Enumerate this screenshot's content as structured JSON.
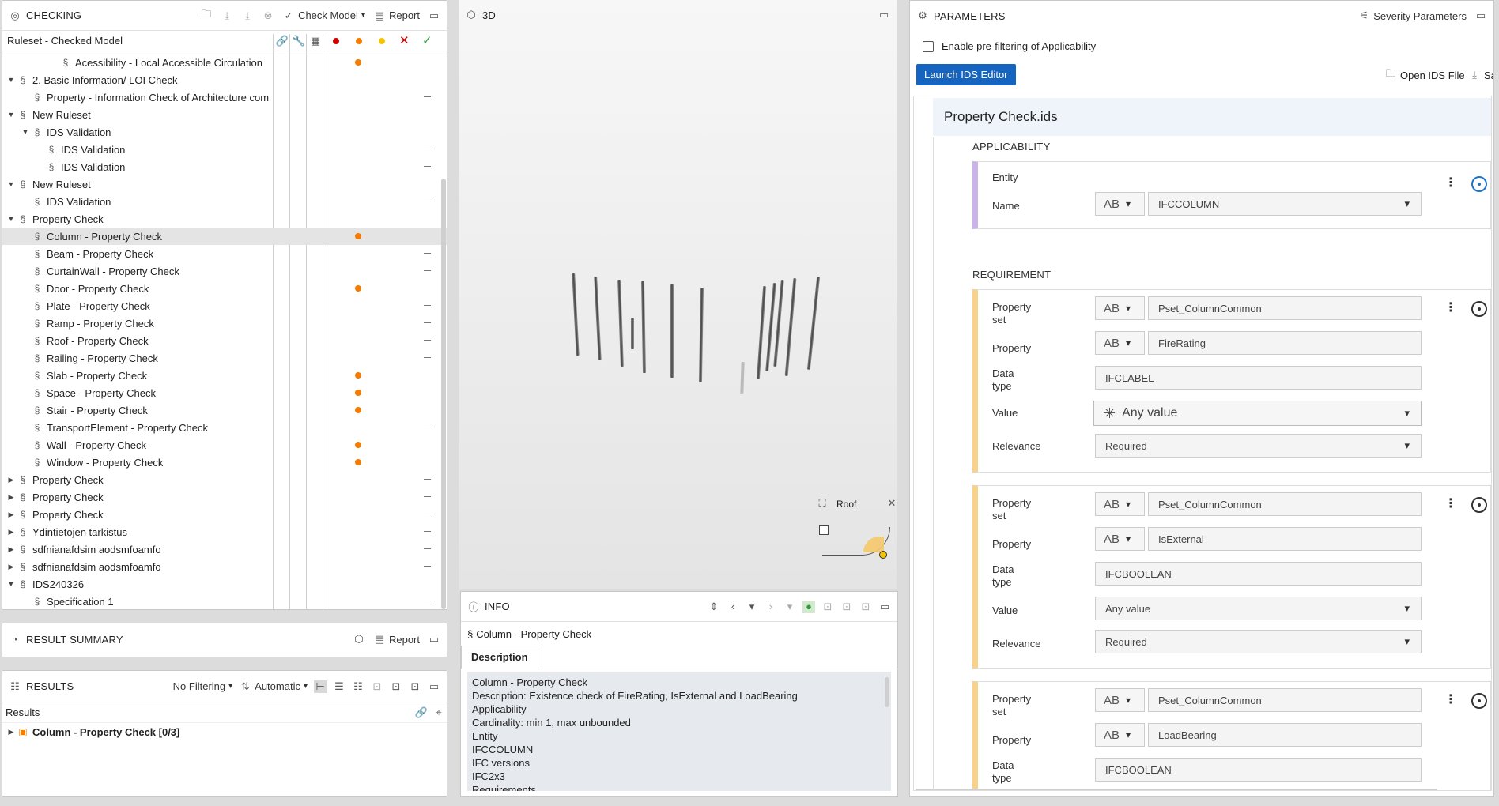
{
  "checking": {
    "title": "CHECKING",
    "check_model": "Check Model",
    "report": "Report",
    "tree_header": "Ruleset - Checked Model",
    "rows": [
      {
        "level": 3,
        "toggle": "",
        "glyph": "§",
        "label": "Acessibility - Local Accessible Circulation",
        "status": "dot"
      },
      {
        "level": 0,
        "toggle": "▼",
        "glyph": "§",
        "label": "2. Basic Information/ LOI Check",
        "status": ""
      },
      {
        "level": 1,
        "toggle": "",
        "glyph": "§",
        "label": "Property - Information Check of Architecture com",
        "status": "dash"
      },
      {
        "level": 0,
        "toggle": "▼",
        "glyph": "§",
        "label": "New Ruleset",
        "status": ""
      },
      {
        "level": 1,
        "toggle": "▼",
        "glyph": "§",
        "label": "IDS Validation",
        "status": ""
      },
      {
        "level": 2,
        "toggle": "",
        "glyph": "§",
        "label": "IDS Validation",
        "status": "dash"
      },
      {
        "level": 2,
        "toggle": "",
        "glyph": "§",
        "label": "IDS Validation",
        "status": "dash"
      },
      {
        "level": 0,
        "toggle": "▼",
        "glyph": "§",
        "label": "New Ruleset",
        "status": ""
      },
      {
        "level": 1,
        "toggle": "",
        "glyph": "§",
        "label": "IDS Validation",
        "status": "dash"
      },
      {
        "level": 0,
        "toggle": "▼",
        "glyph": "§",
        "label": "Property Check",
        "status": ""
      },
      {
        "level": 1,
        "toggle": "",
        "glyph": "§",
        "label": "Column - Property Check",
        "status": "dot",
        "selected": true
      },
      {
        "level": 1,
        "toggle": "",
        "glyph": "§",
        "label": "Beam - Property Check",
        "status": "dash"
      },
      {
        "level": 1,
        "toggle": "",
        "glyph": "§",
        "label": "CurtainWall - Property Check",
        "status": "dash"
      },
      {
        "level": 1,
        "toggle": "",
        "glyph": "§",
        "label": "Door - Property Check",
        "status": "dot"
      },
      {
        "level": 1,
        "toggle": "",
        "glyph": "§",
        "label": "Plate - Property Check",
        "status": "dash"
      },
      {
        "level": 1,
        "toggle": "",
        "glyph": "§",
        "label": "Ramp - Property Check",
        "status": "dash"
      },
      {
        "level": 1,
        "toggle": "",
        "glyph": "§",
        "label": "Roof - Property Check",
        "status": "dash"
      },
      {
        "level": 1,
        "toggle": "",
        "glyph": "§",
        "label": "Railing - Property Check",
        "status": "dash"
      },
      {
        "level": 1,
        "toggle": "",
        "glyph": "§",
        "label": "Slab - Property Check",
        "status": "dot"
      },
      {
        "level": 1,
        "toggle": "",
        "glyph": "§",
        "label": "Space - Property Check",
        "status": "dot"
      },
      {
        "level": 1,
        "toggle": "",
        "glyph": "§",
        "label": "Stair - Property Check",
        "status": "dot"
      },
      {
        "level": 1,
        "toggle": "",
        "glyph": "§",
        "label": "TransportElement - Property Check",
        "status": "dash"
      },
      {
        "level": 1,
        "toggle": "",
        "glyph": "§",
        "label": "Wall - Property Check",
        "status": "dot"
      },
      {
        "level": 1,
        "toggle": "",
        "glyph": "§",
        "label": "Window - Property Check",
        "status": "dot"
      },
      {
        "level": 0,
        "toggle": "▶",
        "glyph": "§",
        "label": "Property Check",
        "status": "dash"
      },
      {
        "level": 0,
        "toggle": "▶",
        "glyph": "§",
        "label": "Property Check",
        "status": "dash"
      },
      {
        "level": 0,
        "toggle": "▶",
        "glyph": "§",
        "label": "Property Check",
        "status": "dash"
      },
      {
        "level": 0,
        "toggle": "▶",
        "glyph": "§",
        "label": "Ydintietojen tarkistus",
        "status": "dash"
      },
      {
        "level": 0,
        "toggle": "▶",
        "glyph": "§",
        "label": "sdfnianafdsim aodsmfoamfo",
        "status": "dash"
      },
      {
        "level": 0,
        "toggle": "▶",
        "glyph": "§",
        "label": "sdfnianafdsim aodsmfoamfo",
        "status": "dash"
      },
      {
        "level": 0,
        "toggle": "▼",
        "glyph": "§",
        "label": "IDS240326",
        "status": ""
      },
      {
        "level": 1,
        "toggle": "",
        "glyph": "§",
        "label": "Specification 1",
        "status": "dash"
      }
    ]
  },
  "result_summary": {
    "title": "RESULT SUMMARY",
    "report": "Report"
  },
  "results": {
    "title": "RESULTS",
    "filter": "No Filtering",
    "mode": "Automatic",
    "header": "Results",
    "row": "Column - Property Check [0/3]"
  },
  "viewer": {
    "title": "3D",
    "nav_label": "Roof"
  },
  "info": {
    "title": "INFO",
    "item": "Column - Property Check",
    "tab": "Description",
    "lines": [
      "Column - Property Check",
      "Description: Existence check of FireRating, IsExternal and LoadBearing",
      "Applicability",
      "Cardinality: min 1, max unbounded",
      "Entity",
      "IFCCOLUMN",
      "IFC versions",
      "IFC2x3",
      "Requirements"
    ]
  },
  "parameters": {
    "title": "PARAMETERS",
    "severity": "Severity Parameters",
    "prefilter_label": "Enable pre-filtering of Applicability",
    "launch": "Launch IDS Editor",
    "open_file": "Open IDS File",
    "save": "Sa",
    "file_title": "Property Check.ids",
    "applicability_title": "APPLICABILITY",
    "requirement_title": "REQUIREMENT",
    "ab": "AB",
    "labels": {
      "entity": "Entity",
      "name": "Name",
      "property": "Property",
      "set": "set",
      "data": "Data",
      "type": "type",
      "value": "Value",
      "relevance": "Relevance"
    },
    "entity_name": "IFCCOLUMN",
    "requirements": [
      {
        "pset": "Pset_ColumnCommon",
        "property": "FireRating",
        "datatype": "IFCLABEL",
        "value": "Any value",
        "relevance": "Required"
      },
      {
        "pset": "Pset_ColumnCommon",
        "property": "IsExternal",
        "datatype": "IFCBOOLEAN",
        "value": "Any value",
        "relevance": "Required"
      },
      {
        "pset": "Pset_ColumnCommon",
        "property": "LoadBearing",
        "datatype": "IFCBOOLEAN"
      }
    ]
  },
  "colors": {
    "accent": "#1565c0",
    "status_orange": "#f47c00",
    "status_red": "#d00000",
    "status_yellow": "#f5c400",
    "status_green": "#2e9e3a"
  }
}
